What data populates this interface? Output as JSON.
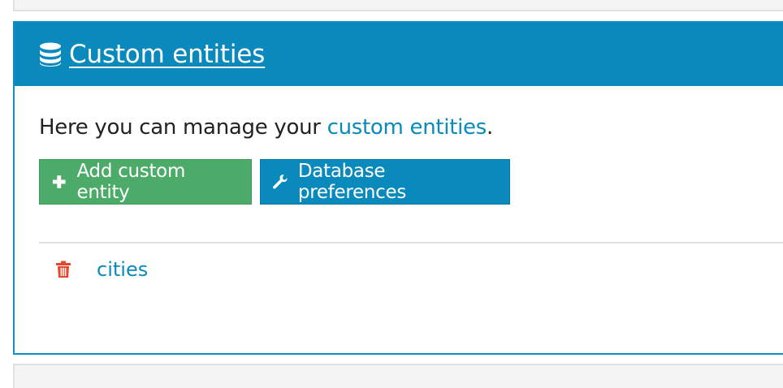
{
  "panel": {
    "title": "Custom entities",
    "title_icon": "database-icon",
    "intro_prefix": "Here you can manage your ",
    "intro_link": "custom entities",
    "intro_suffix": "."
  },
  "buttons": {
    "add_label": "Add custom entity",
    "add_icon": "plus-icon",
    "db_prefs_label": "Database preferences",
    "db_prefs_icon": "wrench-icon"
  },
  "entities": [
    {
      "name": "cities",
      "delete_icon": "trash-icon"
    }
  ],
  "colors": {
    "header_bg": "#0a8abc",
    "add_button_bg": "#4cab69",
    "link": "#0a8abc",
    "delete_icon": "#e8462b"
  }
}
